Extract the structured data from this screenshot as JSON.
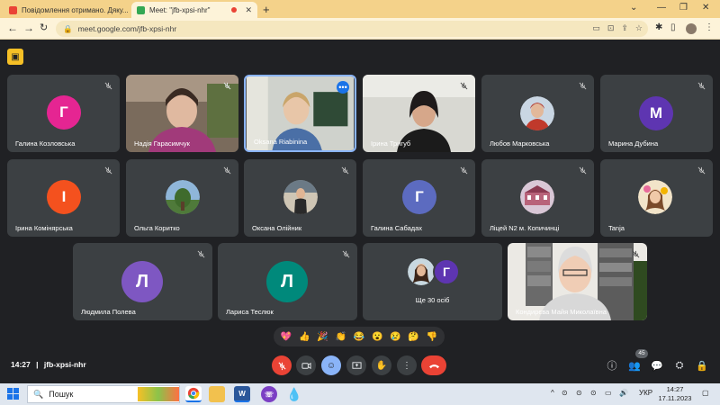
{
  "browser": {
    "tabs": [
      {
        "title": "Повідомлення отримано. Дяку...",
        "active": false,
        "favicon_color": "#ea4335"
      },
      {
        "title": "Meet: \"jfb-xpsi-nhr\"",
        "active": true,
        "favicon_color": "#34a853"
      }
    ],
    "new_tab_label": "+",
    "url": "meet.google.com/jfb-xpsi-nhr"
  },
  "participants_row1": [
    {
      "name": "Галина Козловська",
      "initial": "Г",
      "color": "#e52592"
    },
    {
      "name": "Надія Гарасимчук",
      "video": true
    },
    {
      "name": "Oksana Riabinina",
      "video": true,
      "active_speaker": true
    },
    {
      "name": "Ірина Тригуб",
      "video": true
    },
    {
      "name": "Любов Марковська",
      "photo": true
    },
    {
      "name": "Марина Дубина",
      "initial": "М",
      "color": "#5e35b1"
    }
  ],
  "participants_row2": [
    {
      "name": "Ірина Комінярська",
      "initial": "І",
      "color": "#f4511e"
    },
    {
      "name": "Ольга Коритко",
      "photo": true
    },
    {
      "name": "Оксана Олійник",
      "photo": true
    },
    {
      "name": "Галина Сабадах",
      "initial": "Г",
      "color": "#5c6bc0"
    },
    {
      "name": "Ліцей N2 м. Копичинці",
      "photo": true
    },
    {
      "name": "Tanja",
      "photo": true
    }
  ],
  "participants_row3": [
    {
      "name": "Людмила Полева",
      "initial": "Л",
      "color": "#7e57c2"
    },
    {
      "name": "Лариса Теслюк",
      "initial": "Л",
      "color": "#00897b"
    },
    {
      "name": "Ще 30 осіб",
      "group": true,
      "group_initial": "Г"
    },
    {
      "name": "Кондирєва Майя Миколаївна",
      "video": true
    }
  ],
  "reactions": [
    "💖",
    "👍",
    "🎉",
    "👏",
    "😂",
    "😮",
    "😢",
    "🤔",
    "👎"
  ],
  "meeting": {
    "time": "14:27",
    "separator": "|",
    "code": "jfb-xpsi-nhr"
  },
  "people_count": "45",
  "taskbar": {
    "search_placeholder": "Пошук",
    "language": "УКР",
    "time": "14:27",
    "date": "17.11.2023"
  }
}
